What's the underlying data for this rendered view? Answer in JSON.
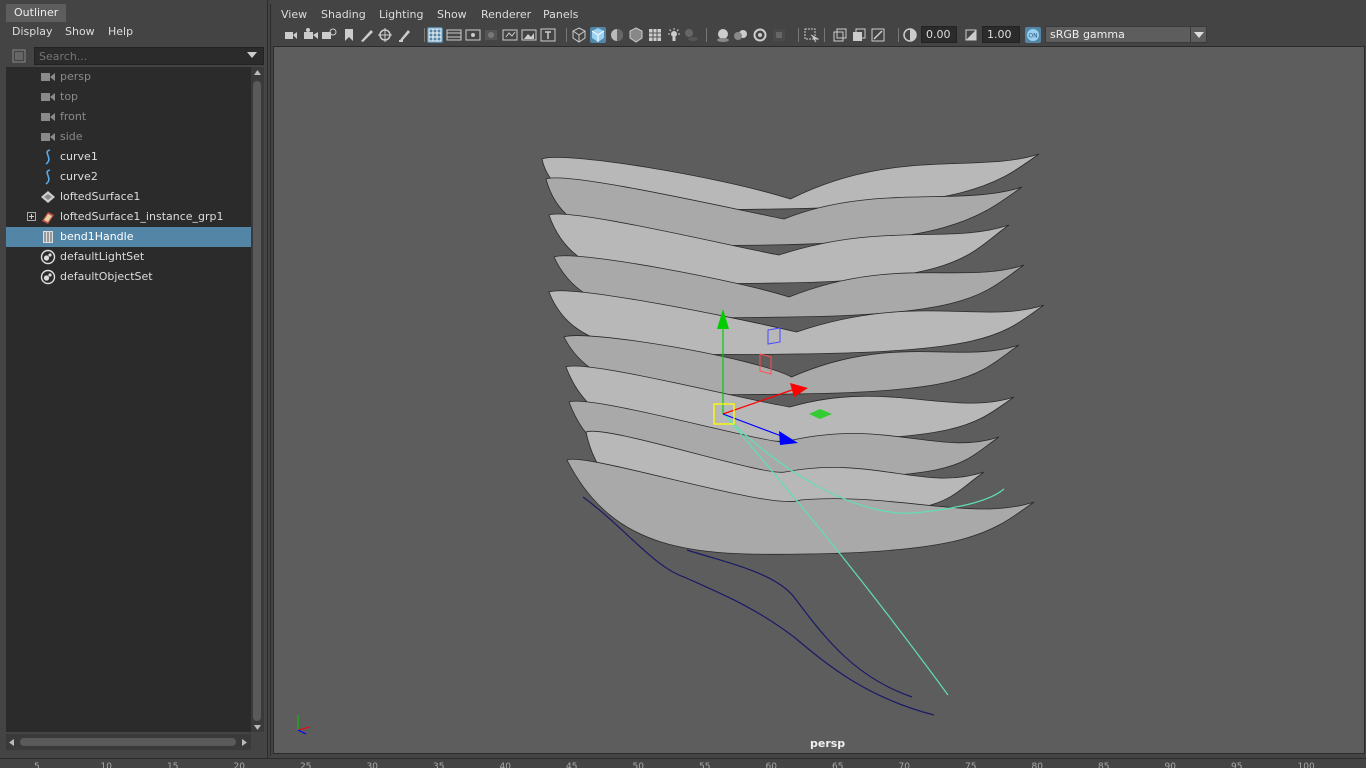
{
  "outliner": {
    "tab_label": "Outliner",
    "menu": [
      "Display",
      "Show",
      "Help"
    ],
    "search_placeholder": "Search...",
    "items": [
      {
        "label": "persp",
        "icon": "camera-icon",
        "dim": true
      },
      {
        "label": "top",
        "icon": "camera-icon",
        "dim": true
      },
      {
        "label": "front",
        "icon": "camera-icon",
        "dim": true
      },
      {
        "label": "side",
        "icon": "camera-icon",
        "dim": true
      },
      {
        "label": "curve1",
        "icon": "nurbs-curve-icon",
        "dim": false
      },
      {
        "label": "curve2",
        "icon": "nurbs-curve-icon",
        "dim": false
      },
      {
        "label": "loftedSurface1",
        "icon": "nurbs-surface-icon",
        "dim": false
      },
      {
        "label": "loftedSurface1_instance_grp1",
        "icon": "group-icon",
        "dim": false,
        "expandable": true
      },
      {
        "label": "bend1Handle",
        "icon": "deformer-handle-icon",
        "dim": false,
        "selected": true
      },
      {
        "label": "defaultLightSet",
        "icon": "set-icon",
        "dim": false
      },
      {
        "label": "defaultObjectSet",
        "icon": "set-icon",
        "dim": false
      }
    ]
  },
  "viewport": {
    "menu": [
      "View",
      "Shading",
      "Lighting",
      "Show",
      "Renderer",
      "Panels"
    ],
    "exposure": "0.00",
    "gamma": "1.00",
    "color_space": "sRGB gamma",
    "camera_label": "persp",
    "colors": {
      "background": "#5d5d5d",
      "surface": "#b8b8b8",
      "curve1": "#1a1a66",
      "curve2": "#5fe0b0",
      "manip_y": "#00cc00",
      "manip_x": "#ff0000",
      "manip_z": "#0000ff",
      "selection": "#5285a6"
    }
  },
  "timeline": {
    "ticks": [
      "5",
      "10",
      "15",
      "20",
      "25",
      "30",
      "35",
      "40",
      "45",
      "50",
      "55",
      "60",
      "65",
      "70",
      "75",
      "80",
      "85",
      "90",
      "95",
      "100"
    ]
  }
}
